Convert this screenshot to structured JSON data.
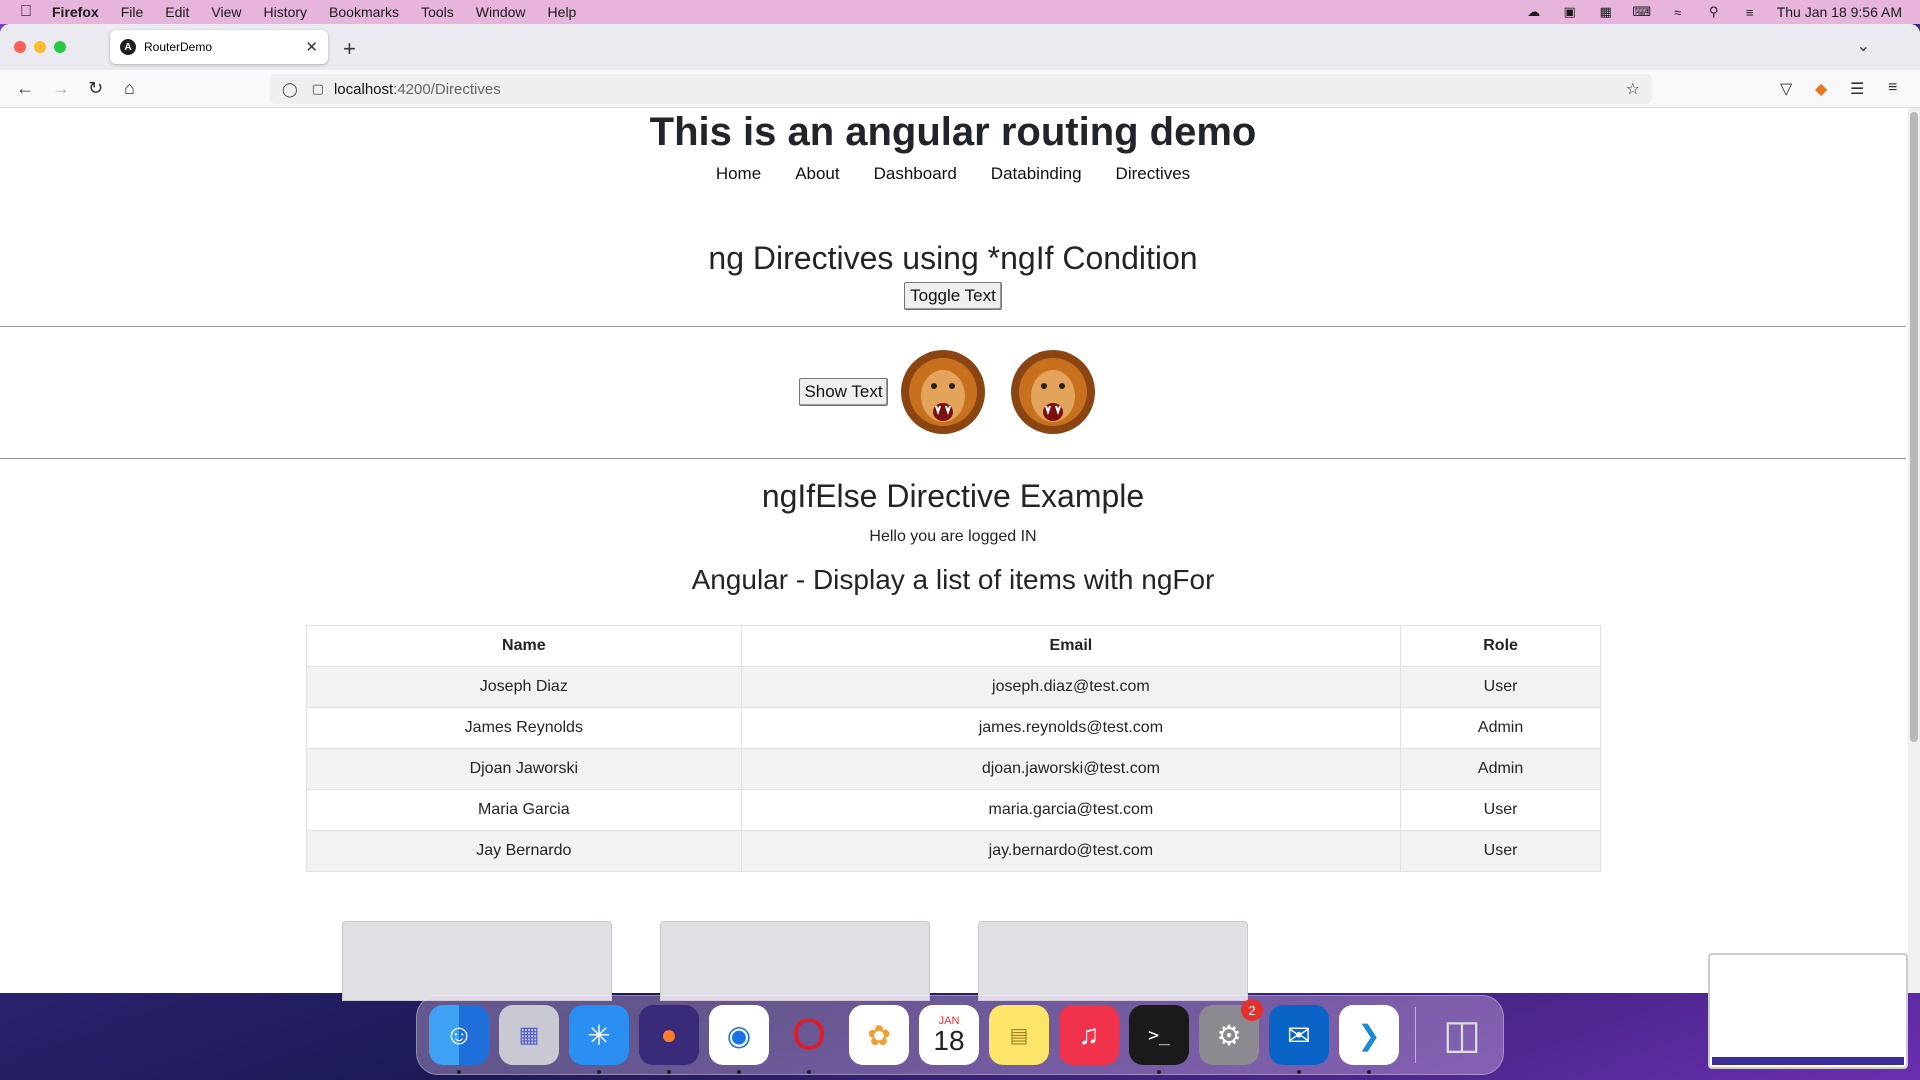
{
  "menubar": {
    "app": "Firefox",
    "items": [
      "File",
      "Edit",
      "View",
      "History",
      "Bookmarks",
      "Tools",
      "Window",
      "Help"
    ],
    "datetime": "Thu Jan 18  9:56 AM"
  },
  "browser": {
    "tab_title": "RouterDemo",
    "url_host": "localhost",
    "url_path": ":4200/Directives"
  },
  "page": {
    "title": "This is an angular routing demo",
    "nav": [
      "Home",
      "About",
      "Dashboard",
      "Databinding",
      "Directives"
    ],
    "ngif_heading": "ng Directives using *ngIf Condition",
    "toggle_button": "Toggle Text",
    "show_button": "Show Text",
    "ngifelse_heading": "ngIfElse Directive Example",
    "logged_in_text": "Hello you are logged IN",
    "ngfor_heading": "Angular - Display a list of items with ngFor",
    "table": {
      "headers": [
        "Name",
        "Email",
        "Role"
      ],
      "rows": [
        [
          "Joseph Diaz",
          "joseph.diaz@test.com",
          "User"
        ],
        [
          "James Reynolds",
          "james.reynolds@test.com",
          "Admin"
        ],
        [
          "Djoan Jaworski",
          "djoan.jaworski@test.com",
          "Admin"
        ],
        [
          "Maria Garcia",
          "maria.garcia@test.com",
          "User"
        ],
        [
          "Jay Bernardo",
          "jay.bernardo@test.com",
          "User"
        ]
      ]
    }
  },
  "dock": {
    "calendar_month": "JAN",
    "calendar_day": "18",
    "settings_badge": "2",
    "apps": [
      "finder-icon",
      "launchpad-icon",
      "safari-icon",
      "firefox-icon",
      "chrome-icon",
      "opera-icon",
      "photos-icon",
      "calendar-icon",
      "notes-icon",
      "music-icon",
      "terminal-icon",
      "system-settings-icon",
      "outlook-icon",
      "vscode-icon",
      "trash-icon"
    ]
  },
  "colors": {
    "menubar": "#e7b4dc",
    "page_text": "#212529"
  }
}
